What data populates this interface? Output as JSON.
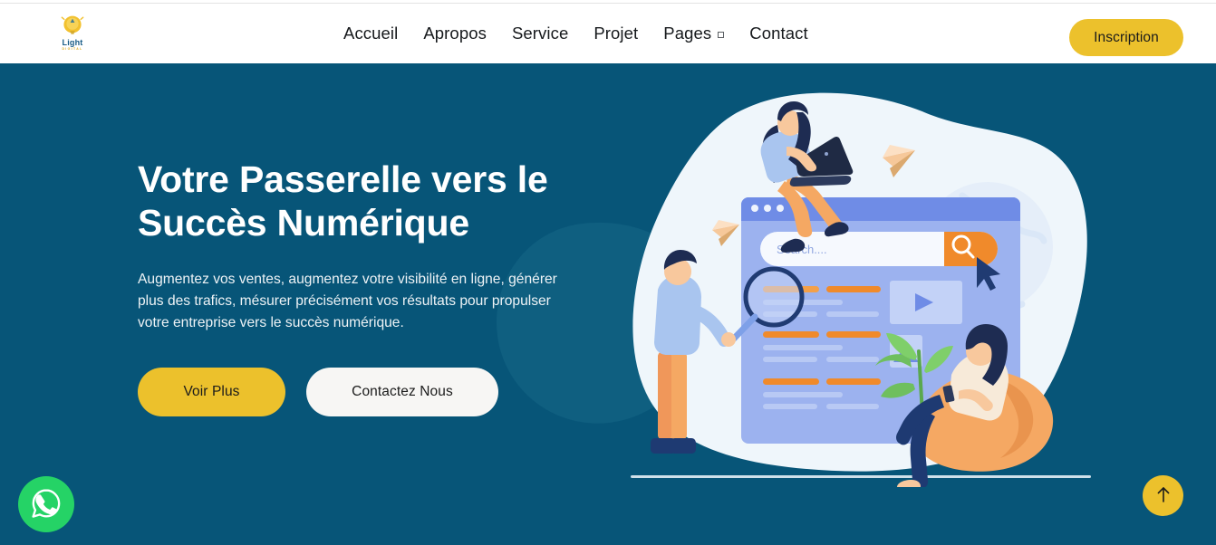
{
  "brand": {
    "name": "Light",
    "tagline": "DIGITAL",
    "logo_icon": "lightbulb-icon"
  },
  "nav": {
    "items": [
      {
        "label": "Accueil",
        "has_dropdown": false
      },
      {
        "label": "Apropos",
        "has_dropdown": false
      },
      {
        "label": "Service",
        "has_dropdown": false
      },
      {
        "label": "Projet",
        "has_dropdown": false
      },
      {
        "label": "Pages",
        "has_dropdown": true
      },
      {
        "label": "Contact",
        "has_dropdown": false
      }
    ],
    "signup_label": "Inscription"
  },
  "hero": {
    "title": "Votre Passerelle vers le Succès Numérique",
    "paragraph": "Augmentez vos ventes, augmentez votre visibilité en ligne, générer plus des trafics, mésurer précisément vos résultats pour propulser votre entreprise vers le succès numérique.",
    "primary_cta": "Voir Plus",
    "secondary_cta": "Contactez Nous",
    "illustration": {
      "search_placeholder": "Search....",
      "search_icon": "magnifier-icon",
      "play_icon": "play-icon",
      "image_icon": "image-placeholder-icon",
      "cursor_icon": "mouse-pointer-icon"
    }
  },
  "floating": {
    "whatsapp_label": "WhatsApp",
    "whatsapp_icon": "whatsapp-icon",
    "scroll_top_label": "Retour en haut",
    "scroll_top_icon": "arrow-up-icon"
  },
  "colors": {
    "hero_background": "#075578",
    "accent_yellow": "#ecc12c",
    "whatsapp_green": "#25d366",
    "text_light": "#ffffff",
    "nav_text": "#16191c"
  }
}
